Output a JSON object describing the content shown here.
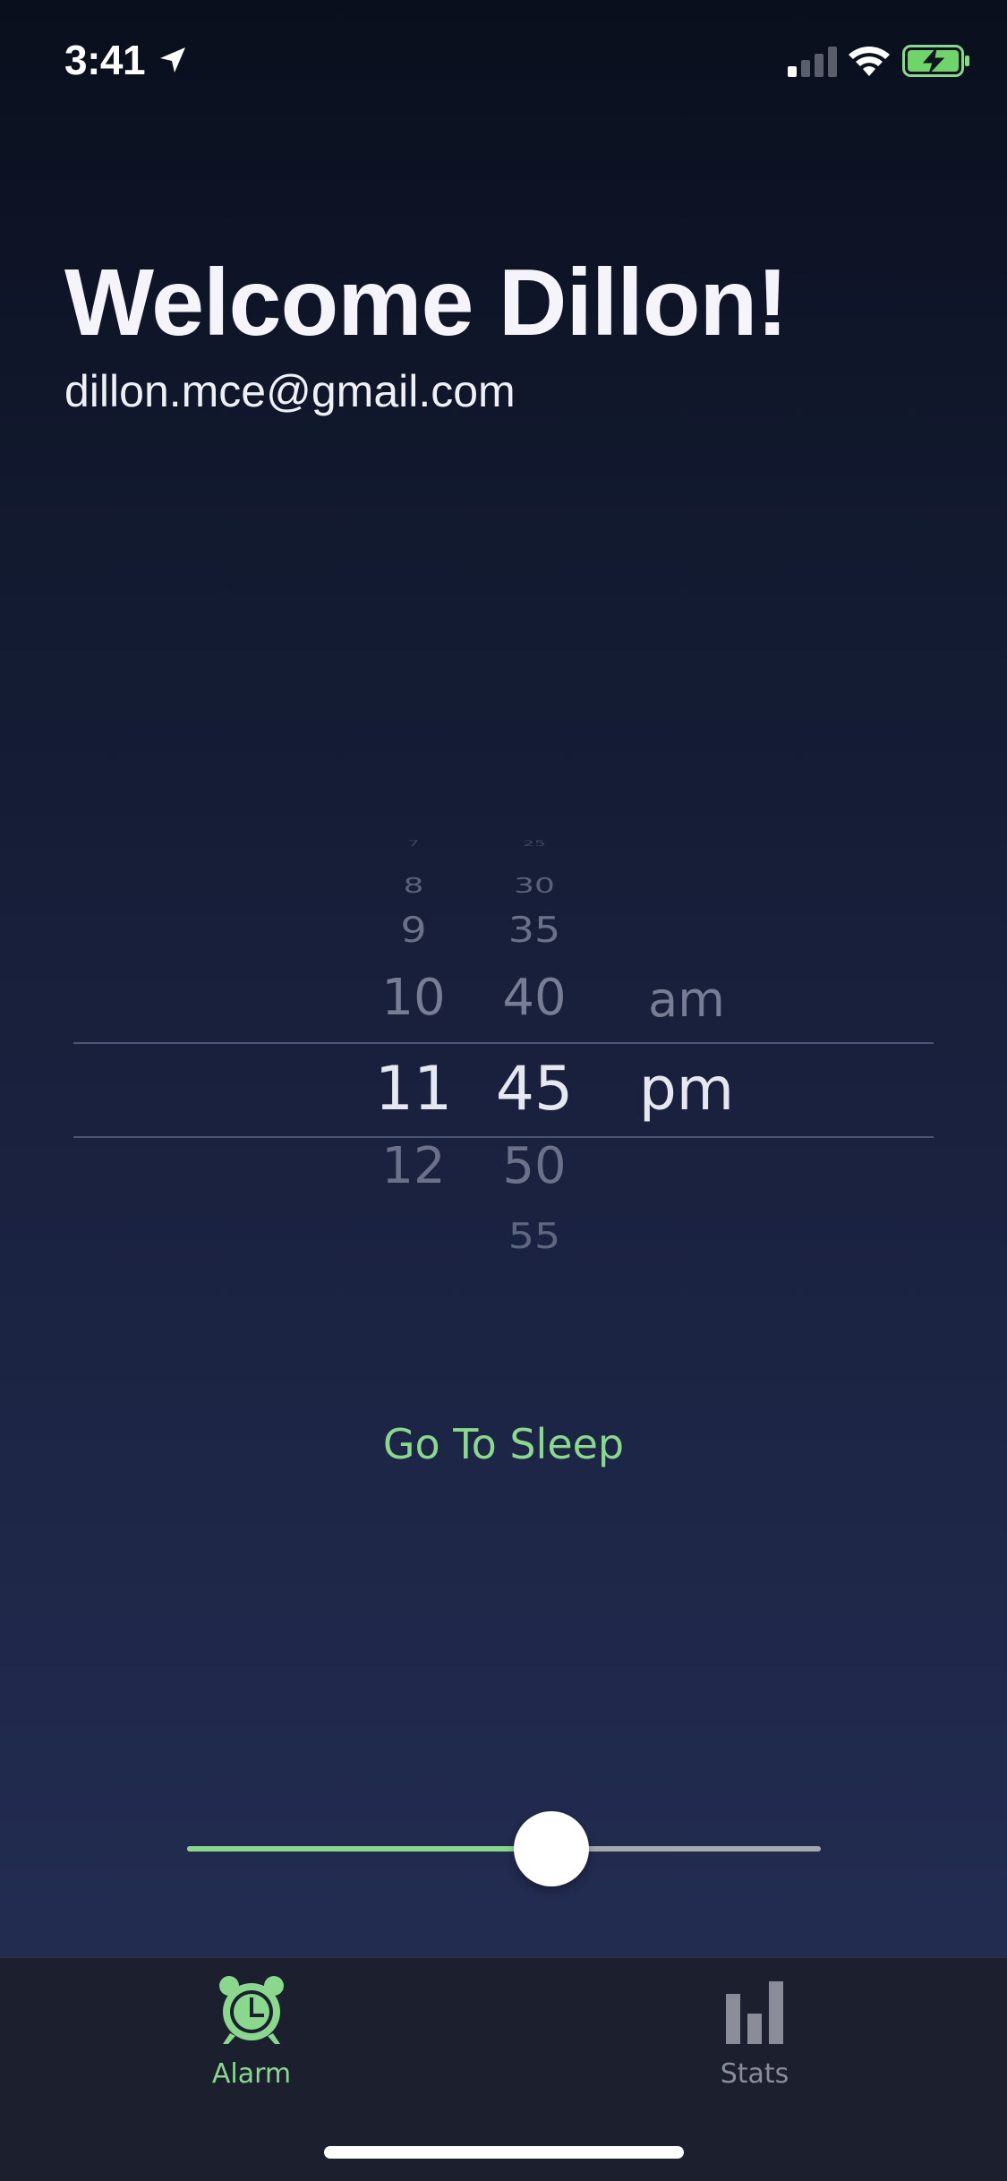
{
  "status_bar": {
    "time": "3:41",
    "icons": [
      "location-arrow-icon",
      "cellular-signal-icon",
      "wifi-icon",
      "battery-charging-icon"
    ]
  },
  "header": {
    "title": "Welcome Dillon!",
    "email": "dillon.mce@gmail.com"
  },
  "picker": {
    "hours": [
      "7",
      "8",
      "9",
      "10",
      "11",
      "12"
    ],
    "selected_hour": "11",
    "minutes": [
      "25",
      "30",
      "35",
      "40",
      "45",
      "50",
      "55"
    ],
    "selected_minute": "45",
    "periods": [
      "am",
      "pm"
    ],
    "selected_period": "pm"
  },
  "actions": {
    "sleep_label": "Go To Sleep"
  },
  "slider": {
    "value": 0.575
  },
  "tabs": [
    {
      "label": "Alarm",
      "icon": "alarm-clock-icon",
      "active": true
    },
    {
      "label": "Stats",
      "icon": "bar-chart-icon",
      "active": false
    }
  ],
  "colors": {
    "accent": "#8ad88e",
    "background_top": "#0a0f1d",
    "background_bottom": "#232c50",
    "tabbar": "#1c1f2e",
    "inactive": "#8a8d97"
  }
}
